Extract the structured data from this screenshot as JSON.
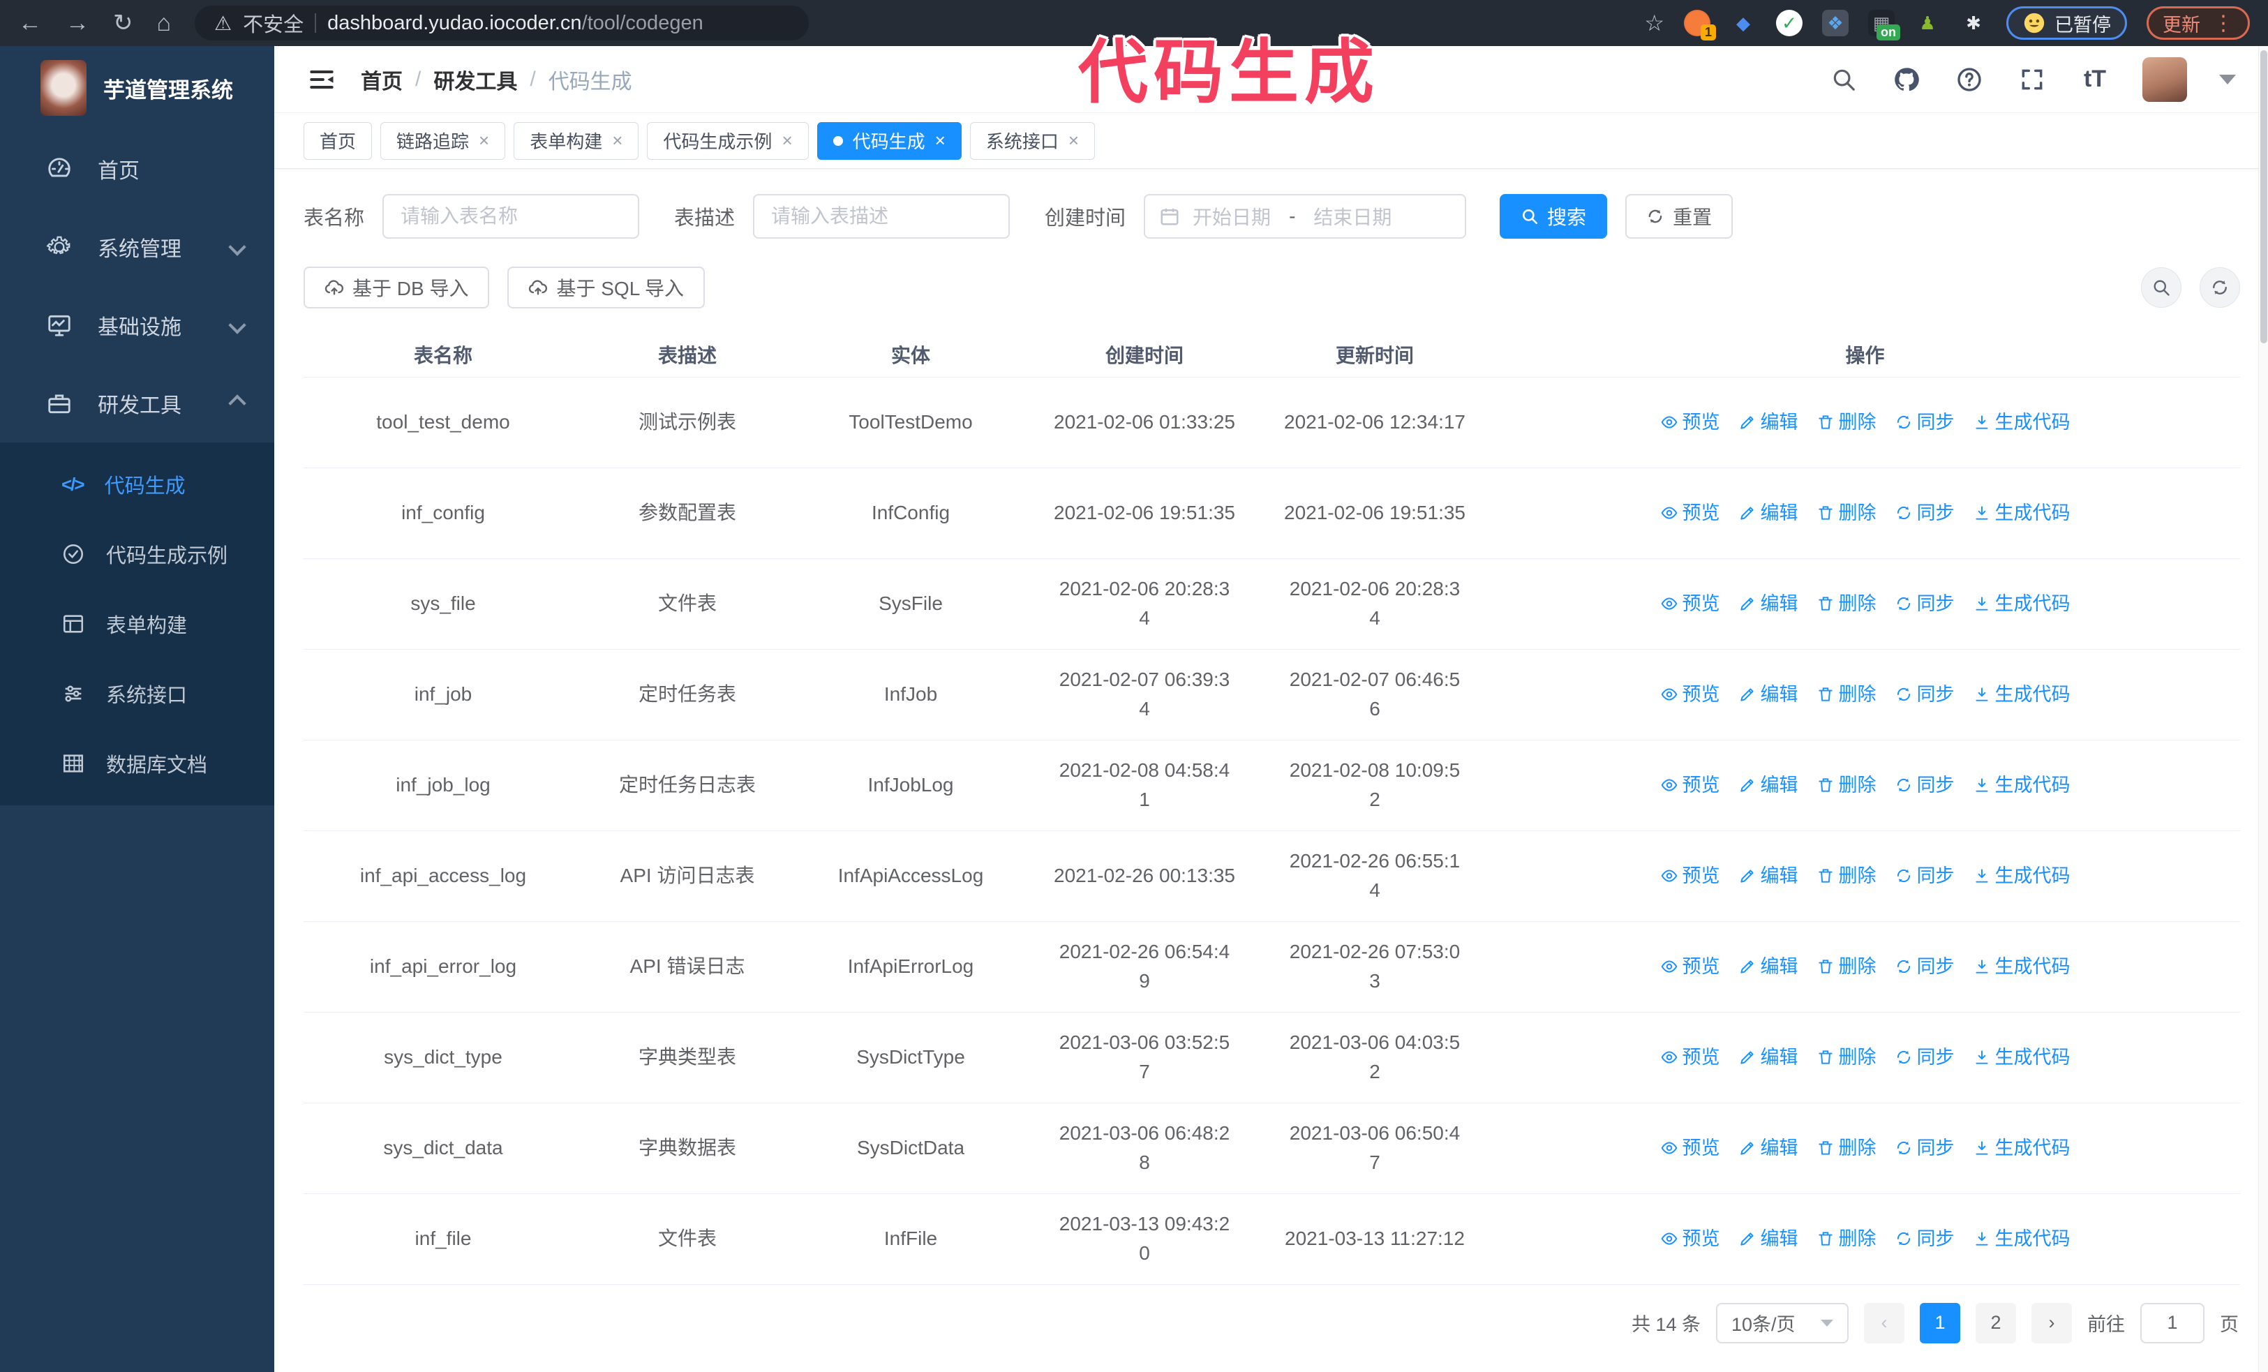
{
  "browser": {
    "security_label": "不安全",
    "url_domain": "dashboard.yudao.iocoder.cn",
    "url_path": "/tool/codegen",
    "extension_badge": "1",
    "extension_on_badge": "on",
    "paused_badge": "已暂停",
    "update_button": "更新"
  },
  "annotation": {
    "text": "代码生成",
    "color": "#f4405f"
  },
  "sidebar": {
    "logo_title": "芋道管理系统",
    "items": [
      {
        "label": "首页"
      },
      {
        "label": "系统管理"
      },
      {
        "label": "基础设施"
      },
      {
        "label": "研发工具"
      }
    ],
    "submenu": [
      {
        "label": "代码生成",
        "active": true
      },
      {
        "label": "代码生成示例"
      },
      {
        "label": "表单构建"
      },
      {
        "label": "系统接口"
      },
      {
        "label": "数据库文档"
      }
    ]
  },
  "header": {
    "breadcrumb": [
      "首页",
      "研发工具",
      "代码生成"
    ]
  },
  "tabs": [
    {
      "label": "首页"
    },
    {
      "label": "链路追踪"
    },
    {
      "label": "表单构建"
    },
    {
      "label": "代码生成示例"
    },
    {
      "label": "代码生成"
    },
    {
      "label": "系统接口"
    }
  ],
  "search": {
    "name_label": "表名称",
    "name_placeholder": "请输入表名称",
    "desc_label": "表描述",
    "desc_placeholder": "请输入表描述",
    "time_label": "创建时间",
    "start_placeholder": "开始日期",
    "range_separator": "-",
    "end_placeholder": "结束日期",
    "search_button": "搜索",
    "reset_button": "重置"
  },
  "toolbar": {
    "import_db": "基于 DB 导入",
    "import_sql": "基于 SQL 导入"
  },
  "table": {
    "columns": [
      "表名称",
      "表描述",
      "实体",
      "创建时间",
      "更新时间",
      "操作"
    ],
    "actions": [
      "预览",
      "编辑",
      "删除",
      "同步",
      "生成代码"
    ],
    "rows": [
      {
        "name": "tool_test_demo",
        "desc": "测试示例表",
        "entity": "ToolTestDemo",
        "created": "2021-02-06 01:33:25",
        "updated": "2021-02-06 12:34:17"
      },
      {
        "name": "inf_config",
        "desc": "参数配置表",
        "entity": "InfConfig",
        "created": "2021-02-06 19:51:35",
        "updated": "2021-02-06 19:51:35"
      },
      {
        "name": "sys_file",
        "desc": "文件表",
        "entity": "SysFile",
        "created": "2021-02-06 20:28:3\n4",
        "updated": "2021-02-06 20:28:3\n4"
      },
      {
        "name": "inf_job",
        "desc": "定时任务表",
        "entity": "InfJob",
        "created": "2021-02-07 06:39:3\n4",
        "updated": "2021-02-07 06:46:5\n6"
      },
      {
        "name": "inf_job_log",
        "desc": "定时任务日志表",
        "entity": "InfJobLog",
        "created": "2021-02-08 04:58:4\n1",
        "updated": "2021-02-08 10:09:5\n2"
      },
      {
        "name": "inf_api_access_log",
        "desc": "API 访问日志表",
        "entity": "InfApiAccessLog",
        "created": "2021-02-26 00:13:35",
        "updated": "2021-02-26 06:55:1\n4"
      },
      {
        "name": "inf_api_error_log",
        "desc": "API 错误日志",
        "entity": "InfApiErrorLog",
        "created": "2021-02-26 06:54:4\n9",
        "updated": "2021-02-26 07:53:0\n3"
      },
      {
        "name": "sys_dict_type",
        "desc": "字典类型表",
        "entity": "SysDictType",
        "created": "2021-03-06 03:52:5\n7",
        "updated": "2021-03-06 04:03:5\n2"
      },
      {
        "name": "sys_dict_data",
        "desc": "字典数据表",
        "entity": "SysDictData",
        "created": "2021-03-06 06:48:2\n8",
        "updated": "2021-03-06 06:50:4\n7"
      },
      {
        "name": "inf_file",
        "desc": "文件表",
        "entity": "InfFile",
        "created": "2021-03-13 09:43:2\n0",
        "updated": "2021-03-13 11:27:12"
      }
    ]
  },
  "pagination": {
    "total": "共 14 条",
    "page_size": "10条/页",
    "pages": [
      "1",
      "2"
    ],
    "goto_label": "前往",
    "goto_value": "1",
    "goto_suffix": "页"
  },
  "colors": {
    "accent": "#1890ff",
    "sidebar_bg": "#213a55",
    "submenu_bg": "#17304a",
    "annotation": "#f4405f"
  }
}
